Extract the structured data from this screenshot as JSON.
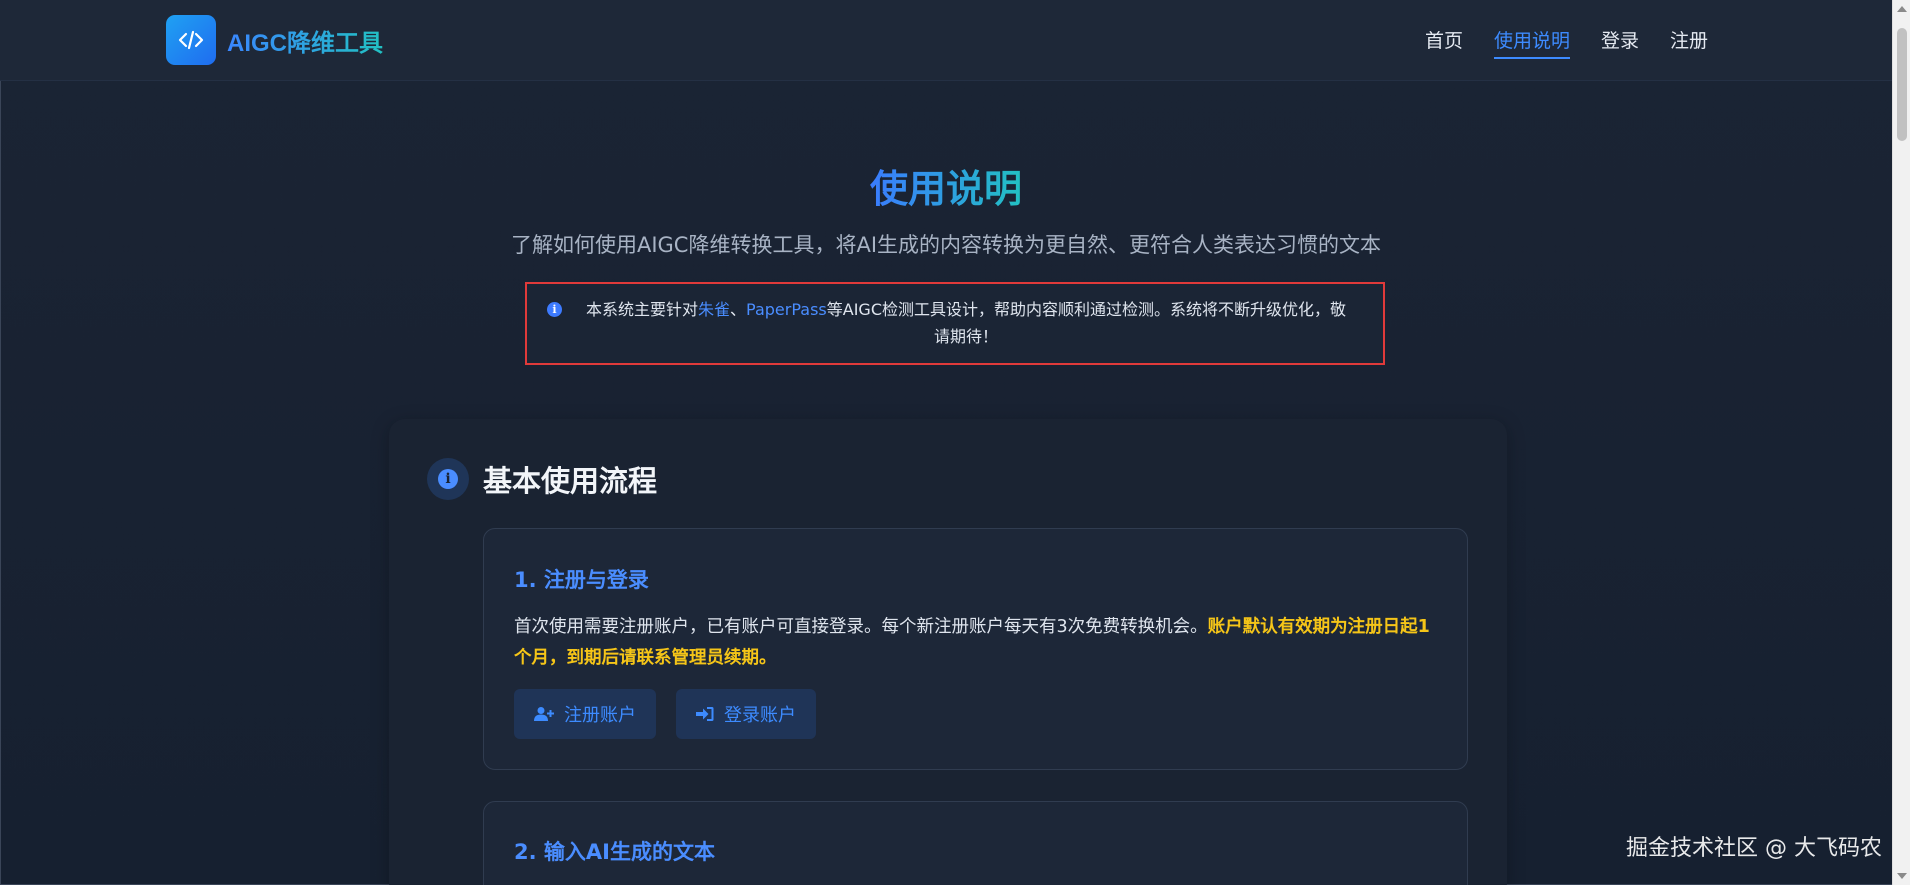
{
  "navbar": {
    "brand_title": "AIGC降维工具",
    "brand_icon": "code-icon",
    "links": [
      {
        "label": "首页",
        "active": false
      },
      {
        "label": "使用说明",
        "active": true
      },
      {
        "label": "登录",
        "active": false
      },
      {
        "label": "注册",
        "active": false
      }
    ]
  },
  "hero": {
    "title": "使用说明",
    "subtitle": "了解如何使用AIGC降维转换工具，将AI生成的内容转换为更自然、更符合人类表达习惯的文本"
  },
  "notice": {
    "icon": "info-icon",
    "text_before": "本系统主要针对",
    "highlight_1": "朱雀",
    "separator": "、",
    "highlight_2": "PaperPass",
    "text_after": "等AIGC检测工具设计，帮助内容顺利通过检测。系统将不断升级优化，敬请期待！"
  },
  "card": {
    "icon": "info-icon",
    "title": "基本使用流程",
    "steps": [
      {
        "title": "1. 注册与登录",
        "desc": "首次使用需要注册账户，已有账户可直接登录。每个新注册账户每天有3次免费转换机会。",
        "warning": "账户默认有效期为注册日起1个月，到期后请联系管理员续期。",
        "buttons": [
          {
            "label": "注册账户",
            "icon": "user-plus-icon"
          },
          {
            "label": "登录账户",
            "icon": "sign-in-icon"
          }
        ]
      },
      {
        "title": "2. 输入AI生成的文本"
      }
    ]
  },
  "watermark": "掘金技术社区 @ 大飞码农",
  "colors": {
    "accent": "#3d8bff",
    "warning": "#f5c518",
    "notice_border": "#e03a3a",
    "background": "#1b2434"
  }
}
